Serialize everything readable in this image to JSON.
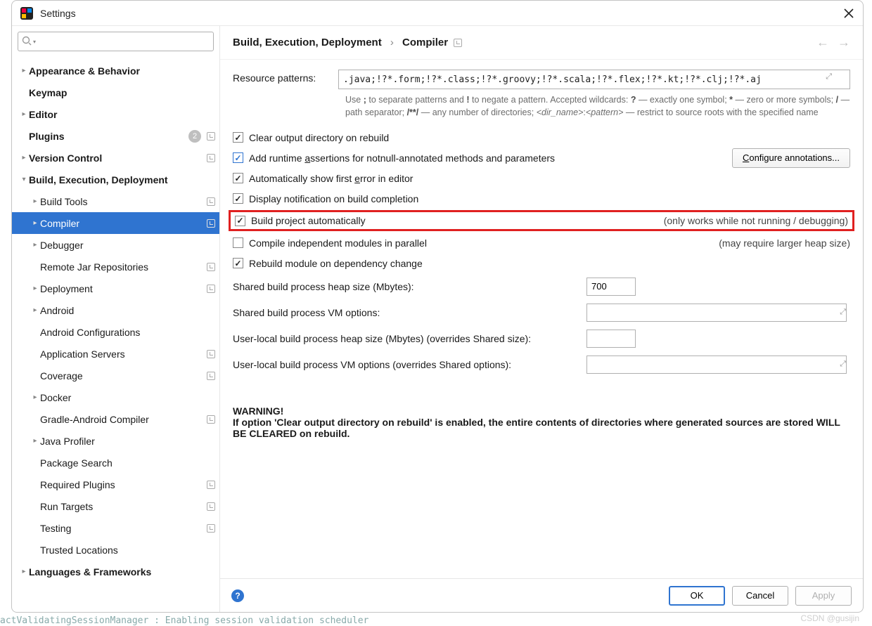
{
  "window": {
    "title": "Settings"
  },
  "search": {
    "placeholder": ""
  },
  "tree": [
    {
      "label": "Appearance & Behavior",
      "depth": 0,
      "exp": "r",
      "bold": true,
      "ind": false
    },
    {
      "label": "Keymap",
      "depth": 0,
      "exp": "",
      "bold": true,
      "ind": false
    },
    {
      "label": "Editor",
      "depth": 0,
      "exp": "r",
      "bold": true,
      "ind": false
    },
    {
      "label": "Plugins",
      "depth": 0,
      "exp": "",
      "bold": true,
      "badge": "2",
      "ind": true
    },
    {
      "label": "Version Control",
      "depth": 0,
      "exp": "r",
      "bold": true,
      "ind": true
    },
    {
      "label": "Build, Execution, Deployment",
      "depth": 0,
      "exp": "d",
      "bold": true,
      "ind": false
    },
    {
      "label": "Build Tools",
      "depth": 1,
      "exp": "r",
      "bold": false,
      "ind": true
    },
    {
      "label": "Compiler",
      "depth": 1,
      "exp": "r",
      "bold": false,
      "ind": true,
      "selected": true
    },
    {
      "label": "Debugger",
      "depth": 1,
      "exp": "r",
      "bold": false,
      "ind": false
    },
    {
      "label": "Remote Jar Repositories",
      "depth": 1,
      "exp": "",
      "bold": false,
      "ind": true
    },
    {
      "label": "Deployment",
      "depth": 1,
      "exp": "r",
      "bold": false,
      "ind": true
    },
    {
      "label": "Android",
      "depth": 1,
      "exp": "r",
      "bold": false,
      "ind": false
    },
    {
      "label": "Android Configurations",
      "depth": 1,
      "exp": "",
      "bold": false,
      "ind": false
    },
    {
      "label": "Application Servers",
      "depth": 1,
      "exp": "",
      "bold": false,
      "ind": true
    },
    {
      "label": "Coverage",
      "depth": 1,
      "exp": "",
      "bold": false,
      "ind": true
    },
    {
      "label": "Docker",
      "depth": 1,
      "exp": "r",
      "bold": false,
      "ind": false
    },
    {
      "label": "Gradle-Android Compiler",
      "depth": 1,
      "exp": "",
      "bold": false,
      "ind": true
    },
    {
      "label": "Java Profiler",
      "depth": 1,
      "exp": "r",
      "bold": false,
      "ind": false
    },
    {
      "label": "Package Search",
      "depth": 1,
      "exp": "",
      "bold": false,
      "ind": false
    },
    {
      "label": "Required Plugins",
      "depth": 1,
      "exp": "",
      "bold": false,
      "ind": true
    },
    {
      "label": "Run Targets",
      "depth": 1,
      "exp": "",
      "bold": false,
      "ind": true
    },
    {
      "label": "Testing",
      "depth": 1,
      "exp": "",
      "bold": false,
      "ind": true
    },
    {
      "label": "Trusted Locations",
      "depth": 1,
      "exp": "",
      "bold": false,
      "ind": false
    },
    {
      "label": "Languages & Frameworks",
      "depth": 0,
      "exp": "r",
      "bold": true,
      "ind": false
    }
  ],
  "breadcrumb": {
    "root": "Build, Execution, Deployment",
    "leaf": "Compiler"
  },
  "resource": {
    "label": "Resource patterns:",
    "value": ".java;!?*.form;!?*.class;!?*.groovy;!?*.scala;!?*.flex;!?*.kt;!?*.clj;!?*.aj",
    "help_pre": "Use ",
    "help_b1": ";",
    "help_m1": " to separate patterns and ",
    "help_b2": "!",
    "help_m2": " to negate a pattern. Accepted wildcards: ",
    "help_b3": "?",
    "help_m3": " — exactly one symbol; ",
    "help_b4": "*",
    "help_m4": " — zero or more symbols; ",
    "help_b5": "/",
    "help_m5": " — path separator; ",
    "help_b6": "/**/",
    "help_m6": " — any number of directories; ",
    "help_i1": "<dir_name>",
    "help_colon": ":",
    "help_i2": "<pattern>",
    "help_m7": " — restrict to source roots with the specified name"
  },
  "checks": {
    "clear": "Clear output directory on rebuild",
    "assert": "Add runtime assertions for notnull-annotated methods and parameters",
    "configure": "Configure annotations...",
    "autoerr": "Automatically show first error in editor",
    "notify": "Display notification on build completion",
    "buildauto": "Build project automatically",
    "buildauto_side": "(only works while not running / debugging)",
    "parallel": "Compile independent modules in parallel",
    "parallel_side": "(may require larger heap size)",
    "rebuild": "Rebuild module on dependency change"
  },
  "form": {
    "heap": {
      "label": "Shared build process heap size (Mbytes):",
      "value": "700"
    },
    "vm": {
      "label": "Shared build process VM options:",
      "value": ""
    },
    "uheap": {
      "label": "User-local build process heap size (Mbytes) (overrides Shared size):",
      "value": ""
    },
    "uvm": {
      "label": "User-local build process VM options (overrides Shared options):",
      "value": ""
    }
  },
  "warning": {
    "title": "WARNING!",
    "text": "If option 'Clear output directory on rebuild' is enabled, the entire contents of directories where generated sources are stored WILL BE CLEARED on rebuild."
  },
  "footer": {
    "ok": "OK",
    "cancel": "Cancel",
    "apply": "Apply"
  },
  "watermark": "CSDN @gusijin",
  "bg": "actValidatingSessionManager : Enabling session validation scheduler"
}
